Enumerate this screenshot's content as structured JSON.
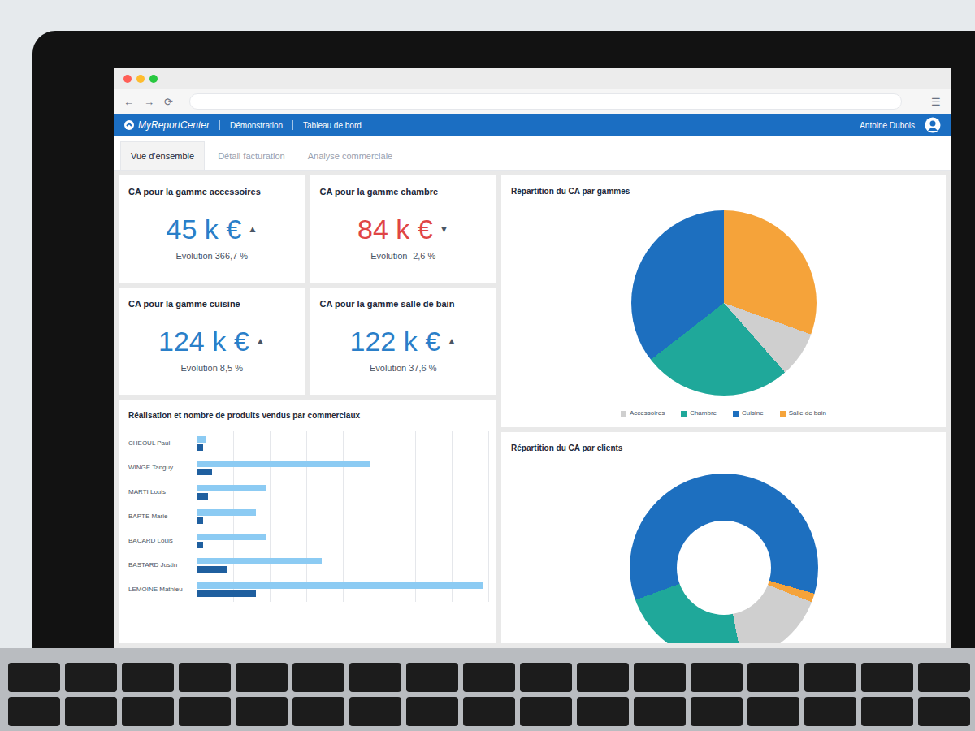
{
  "browser": {
    "controls": [
      "←",
      "→",
      "⟳"
    ],
    "menu": "☰"
  },
  "app": {
    "logo": "MyReportCenter",
    "breadcrumb": [
      "Démonstration",
      "Tableau de bord"
    ],
    "user": "Antoine Dubois"
  },
  "tabs": [
    {
      "label": "Vue d'ensemble",
      "selected": true
    },
    {
      "label": "Détail facturation",
      "selected": false
    },
    {
      "label": "Analyse commerciale",
      "selected": false
    }
  ],
  "kpis": [
    {
      "title": "CA pour la gamme accessoires",
      "value": "45 k €",
      "arrow": "▲",
      "trend": "up",
      "evolution": "Evolution 366,7 %"
    },
    {
      "title": "CA pour la gamme chambre",
      "value": "84 k €",
      "arrow": "▼",
      "trend": "down",
      "evolution": "Evolution -2,6 %"
    },
    {
      "title": "CA pour la gamme cuisine",
      "value": "124 k €",
      "arrow": "▲",
      "trend": "up",
      "evolution": "Evolution 8,5 %"
    },
    {
      "title": "CA pour la gamme salle de bain",
      "value": "122 k €",
      "arrow": "▲",
      "trend": "up",
      "evolution": "Evolution 37,6 %"
    }
  ],
  "pie": {
    "title": "Répartition du CA par gammes",
    "slices": [
      {
        "value": 122,
        "color": "#f5a33a"
      },
      {
        "value": 32,
        "color": "#cfcfcf"
      },
      {
        "value": 104,
        "color": "#1fa89a"
      },
      {
        "value": 142,
        "color": "#1d6fbf"
      }
    ],
    "legend": [
      {
        "label": "Accessoires",
        "color": "#cfcfcf"
      },
      {
        "label": "Chambre",
        "color": "#1fa89a"
      },
      {
        "label": "Cuisine",
        "color": "#1d6fbf"
      },
      {
        "label": "Salle de bain",
        "color": "#f5a33a"
      }
    ]
  },
  "bars": {
    "title": "Réalisation et nombre de produits vendus par commerciaux",
    "categories": [
      "CHEOUL Paul",
      "WINGE Tanguy",
      "MARTI Louis",
      "BAPTE Marie",
      "BACARD Louis",
      "BASTARD Justin",
      "LEMOINE Mathieu"
    ],
    "series": [
      {
        "color": "#8ccbf3",
        "values": [
          6,
          118,
          47,
          40,
          47,
          85,
          195
        ]
      },
      {
        "color": "#1f5f9f",
        "values": [
          4,
          10,
          7,
          4,
          4,
          20,
          40
        ]
      }
    ]
  },
  "donut": {
    "title": "Répartition du CA par clients",
    "slices": [
      {
        "value": 60,
        "color": "#1d6fbf"
      },
      {
        "value": 1.5,
        "color": "#f5a33a"
      },
      {
        "value": 16,
        "color": "#cfcfcf"
      },
      {
        "value": 22.5,
        "color": "#1fa89a"
      }
    ]
  }
}
